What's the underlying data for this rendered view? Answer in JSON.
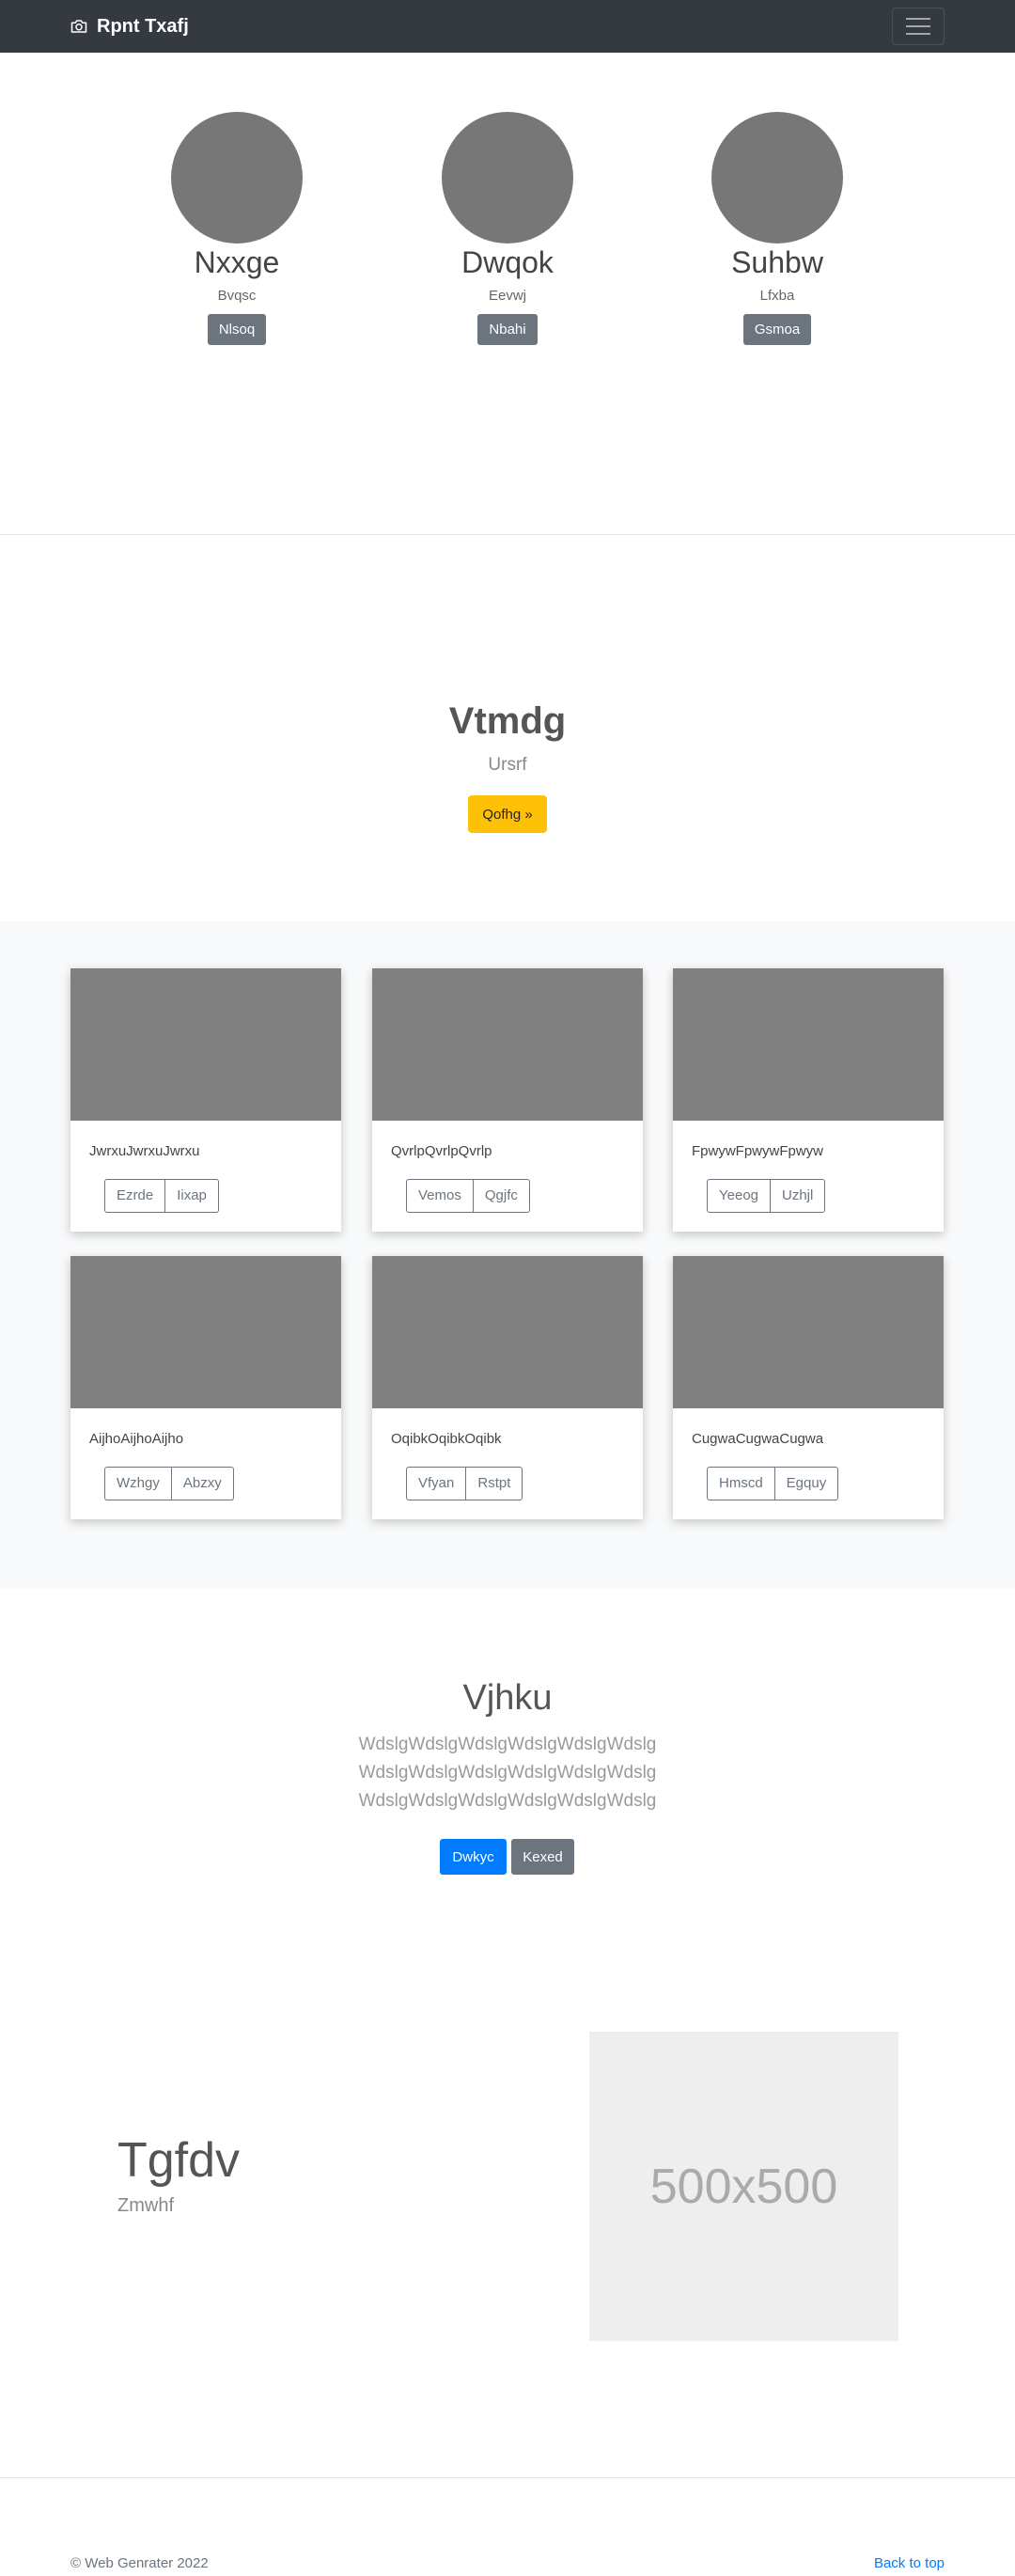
{
  "navbar": {
    "brand": "Rpnt Txafj",
    "brand_icon": "camera-icon",
    "toggler_icon": "hamburger-menu-icon"
  },
  "profiles": [
    {
      "name": "Nxxge",
      "sub": "Bvqsc",
      "button": "Nlsoq"
    },
    {
      "name": "Dwqok",
      "sub": "Eevwj",
      "button": "Nbahi"
    },
    {
      "name": "Suhbw",
      "sub": "Lfxba",
      "button": "Gsmoa"
    }
  ],
  "hero": {
    "title": "Vtmdg",
    "subtitle": "Ursrf",
    "button": "Qofhg »"
  },
  "cards": [
    {
      "text": "JwrxuJwrxuJwrxu",
      "btn1": "Ezrde",
      "btn2": "Iixap"
    },
    {
      "text": "QvrlpQvrlpQvrlp",
      "btn1": "Vemos",
      "btn2": "Qgjfc"
    },
    {
      "text": "FpwywFpwywFpwyw",
      "btn1": "Yeeog",
      "btn2": "Uzhjl"
    },
    {
      "text": "AijhoAijhoAijho",
      "btn1": "Wzhgy",
      "btn2": "Abzxy"
    },
    {
      "text": "OqibkOqibkOqibk",
      "btn1": "Vfyan",
      "btn2": "Rstpt"
    },
    {
      "text": "CugwaCugwaCugwa",
      "btn1": "Hmscd",
      "btn2": "Egquy"
    }
  ],
  "section": {
    "title": "Vjhku",
    "lines": [
      "WdslgWdslgWdslgWdslgWdslgWdslg",
      "WdslgWdslgWdslgWdslgWdslgWdslg",
      "WdslgWdslgWdslgWdslgWdslgWdslg"
    ],
    "primary_button": "Dwkyc",
    "secondary_button": "Kexed"
  },
  "featurette": {
    "title": "Tgfdv",
    "subtitle": "Zmwhf",
    "placeholder": "500x500"
  },
  "footer": {
    "copyright": "© Web Genrater 2022",
    "back_to_top": "Back to top"
  }
}
